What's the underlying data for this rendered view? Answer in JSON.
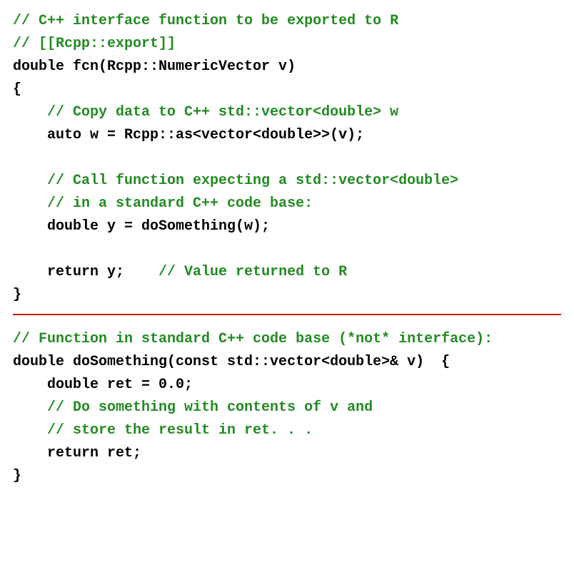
{
  "block1": {
    "line1": "// C++ interface function to be exported to R",
    "line2": "// [[Rcpp::export]]",
    "line3": "double fcn(Rcpp::NumericVector v)",
    "line4": "{",
    "line5": "    // Copy data to C++ std::vector<double> w",
    "line6": "    auto w = Rcpp::as<vector<double>>(v);",
    "line7": "",
    "line8": "    // Call function expecting a std::vector<double>",
    "line9": "    // in a standard C++ code base:",
    "line10": "    double y = doSomething(w);",
    "line11": "",
    "line12a": "    return y;",
    "line12b": "    // Value returned to R",
    "line13": "}"
  },
  "block2": {
    "line1": "// Function in standard C++ code base (*not* interface):",
    "line2": "double doSomething(const std::vector<double>& v)  {",
    "line3": "    double ret = 0.0;",
    "line4": "    // Do something with contents of v and",
    "line5": "    // store the result in ret. . .",
    "line6": "    return ret;",
    "line7": "}"
  }
}
